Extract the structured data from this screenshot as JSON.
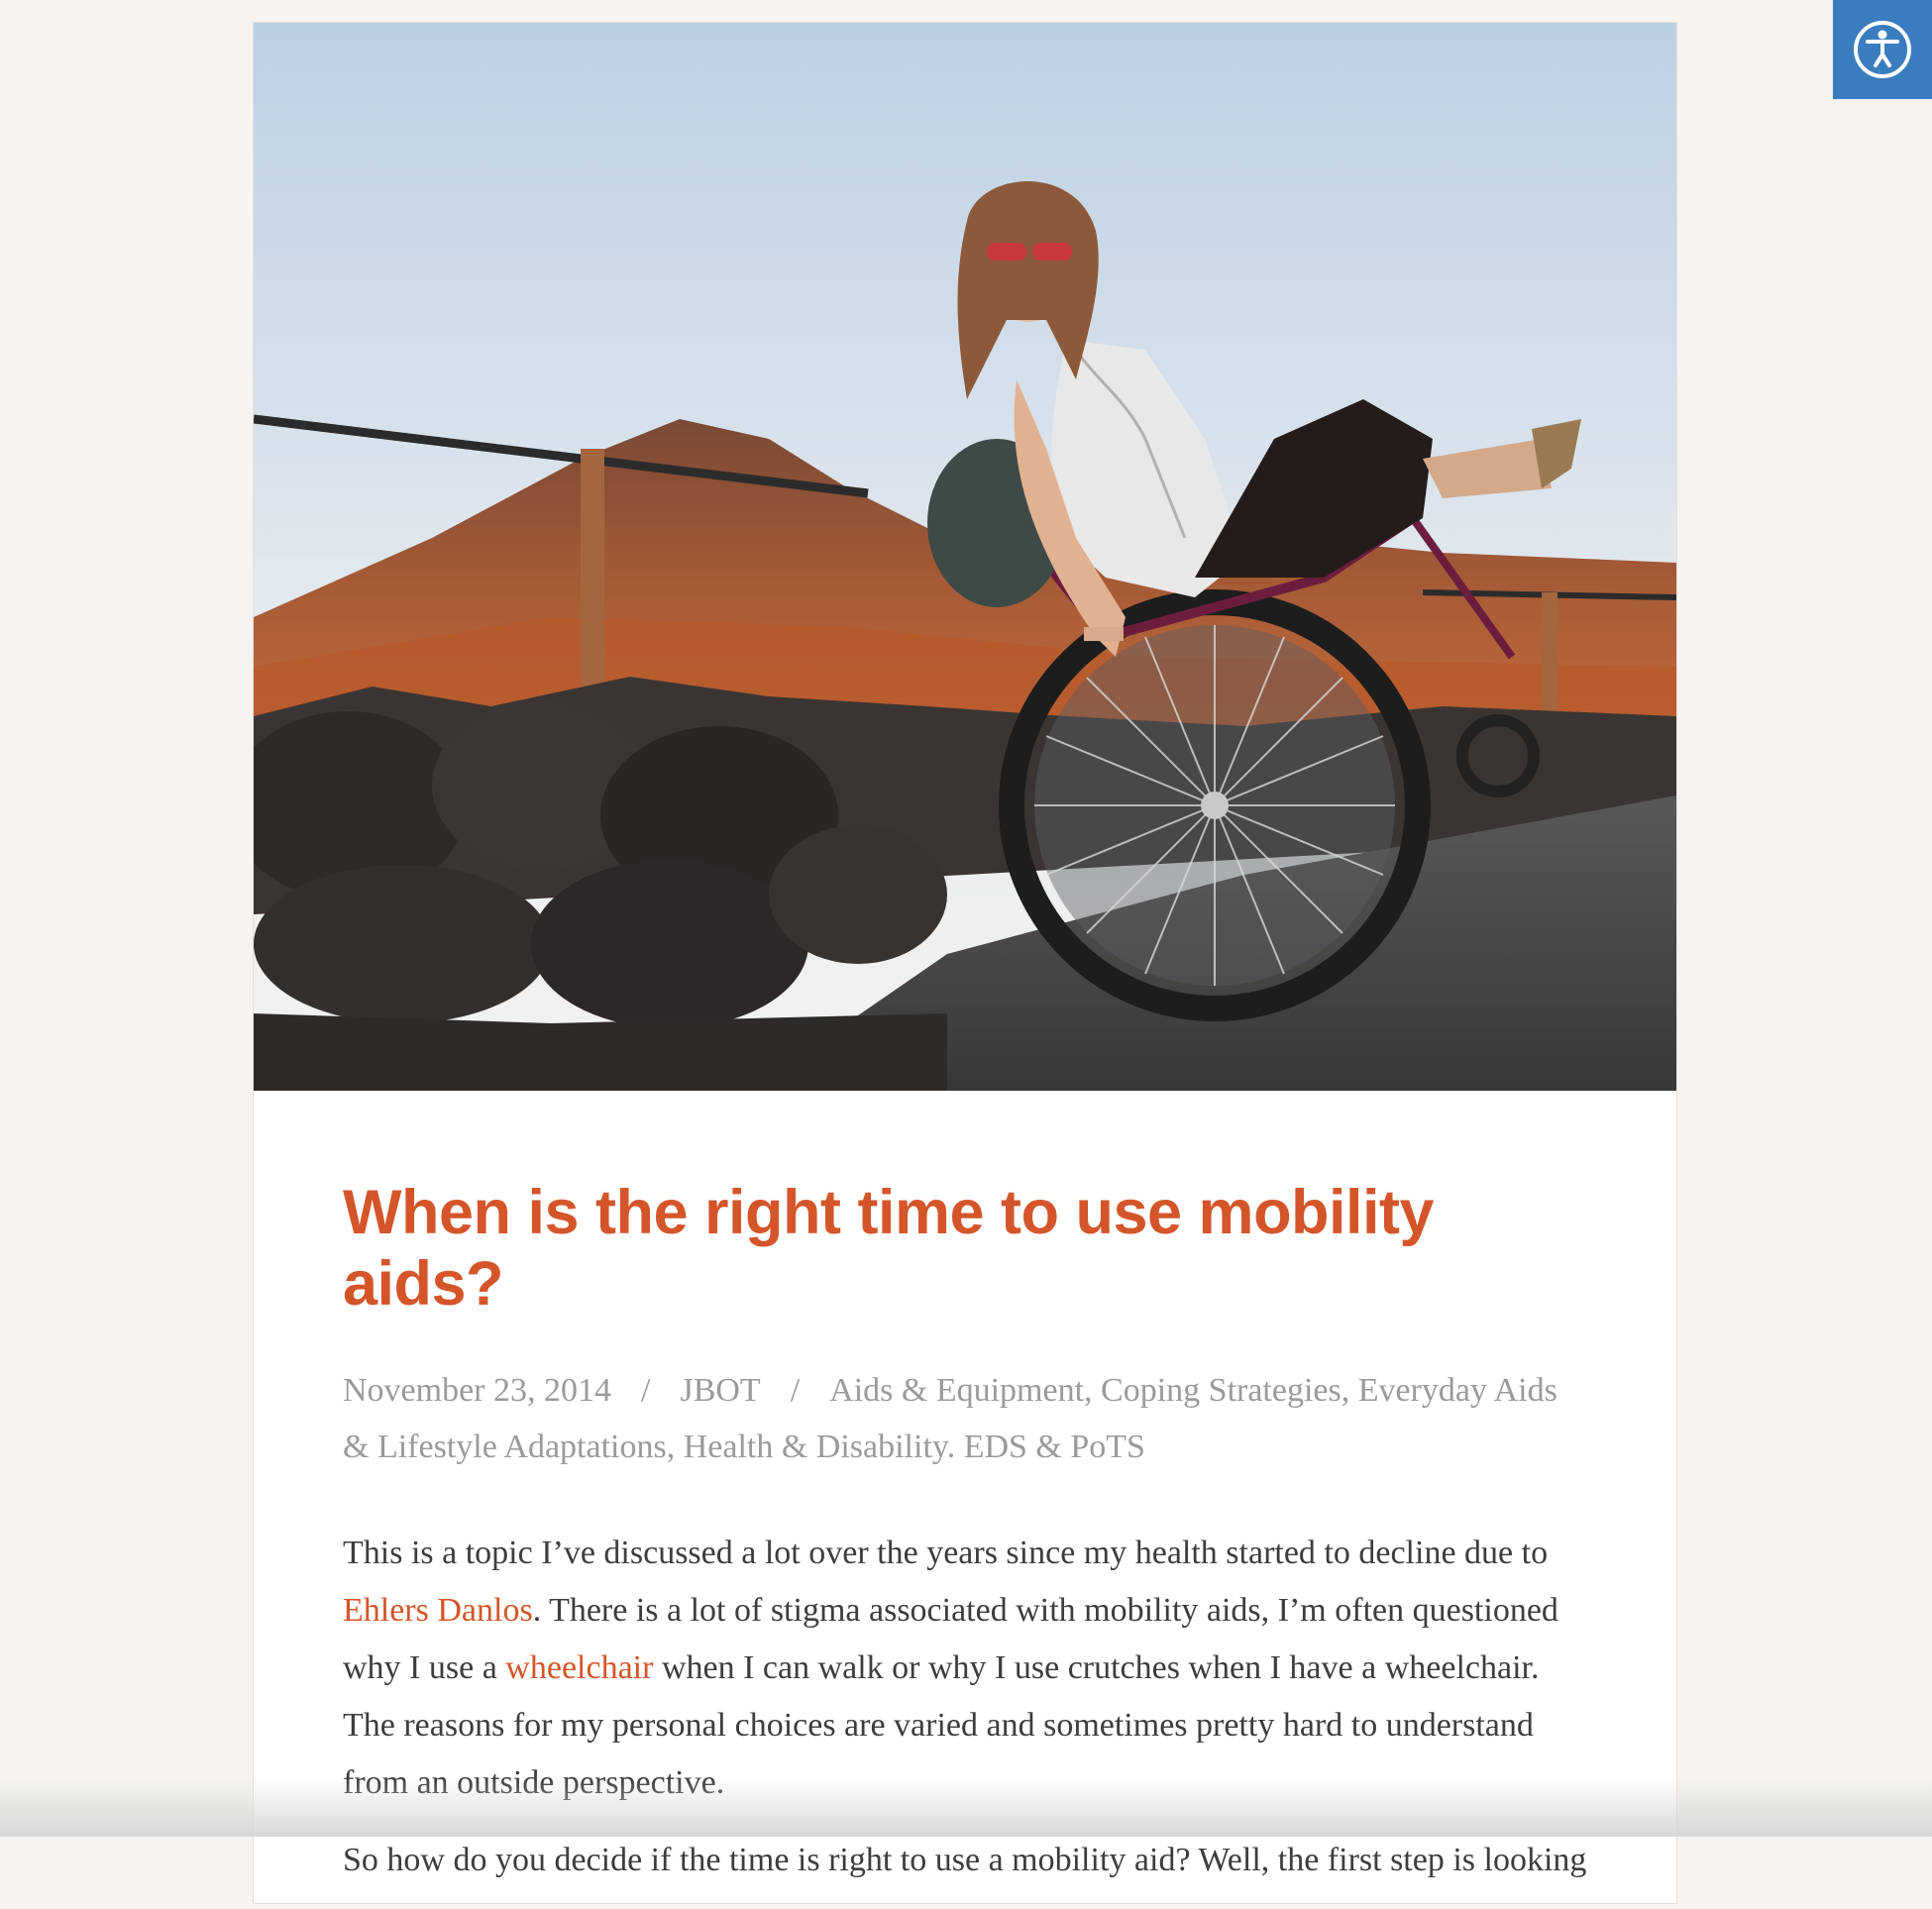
{
  "accessibility": {
    "icon": "accessibility-icon",
    "color": "#3a7dbf"
  },
  "post": {
    "featured_image": "woman-in-wheelchair-on-volcano-path-photo",
    "title": "When is the right time to use mobility aids?",
    "meta": {
      "date": "November 23, 2014",
      "separator": "/",
      "author": "JBOT",
      "categories": "Aids & Equipment, Coping Strategies, Everyday Aids & Lifestyle Adaptations, Health & Disability. EDS & PoTS"
    },
    "content": {
      "p1_a": "This is a topic I’ve discussed a lot over the years since my health started to decline due to ",
      "p1_link1": "Ehlers Danlos",
      "p1_b": ". There is a lot of stigma associated with mobility aids, I’m often questioned why I use a ",
      "p1_link2": "wheelchair",
      "p1_c": " when I can walk or why I use crutches when I have a wheelchair. The reasons for my personal choices are varied and sometimes pretty hard to understand from an outside perspective.",
      "p2": "So how do you decide if the time is right to use a mobility aid? Well, the first step is looking"
    }
  },
  "colors": {
    "accent": "#d4552a",
    "meta": "#9a9a9a",
    "text": "#3d3d3d",
    "page_bg": "#f6f3f0"
  }
}
